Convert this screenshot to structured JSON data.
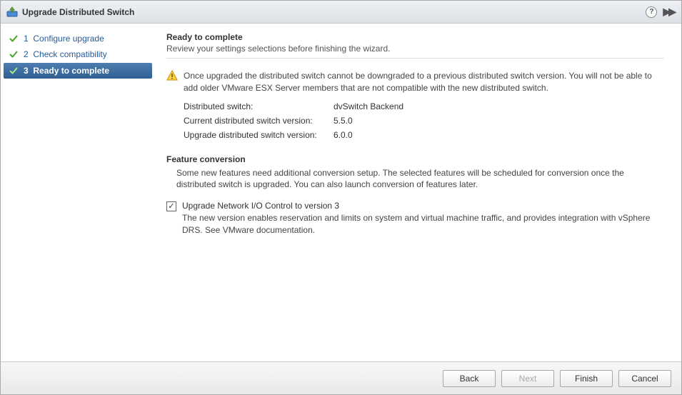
{
  "window": {
    "title": "Upgrade Distributed Switch"
  },
  "steps": [
    {
      "num": "1",
      "label": "Configure upgrade",
      "done": true,
      "active": false
    },
    {
      "num": "2",
      "label": "Check compatibility",
      "done": true,
      "active": false
    },
    {
      "num": "3",
      "label": "Ready to complete",
      "done": true,
      "active": true
    }
  ],
  "main": {
    "heading": "Ready to complete",
    "subtitle": "Review your settings selections before finishing the wizard.",
    "warning": "Once upgraded the distributed switch cannot be downgraded to a previous distributed switch version. You will not be able to add older VMware ESX Server members that are not compatible with the new distributed switch.",
    "info": {
      "switch_label": "Distributed switch:",
      "switch_value": "dvSwitch Backend",
      "current_label": "Current distributed switch version:",
      "current_value": "5.5.0",
      "upgrade_label": "Upgrade distributed switch version:",
      "upgrade_value": "6.0.0"
    },
    "feature_section": {
      "heading": "Feature conversion",
      "text": "Some new features need additional conversion setup. The selected features will be scheduled for conversion once the distributed switch is upgraded. You can also launch conversion of features later.",
      "checkbox_checked": "✓",
      "checkbox_label": "Upgrade Network I/O Control to version 3",
      "checkbox_desc": "The new version enables reservation and limits on system and virtual machine traffic, and provides integration with vSphere DRS. See VMware documentation."
    }
  },
  "buttons": {
    "back": "Back",
    "next": "Next",
    "finish": "Finish",
    "cancel": "Cancel"
  }
}
